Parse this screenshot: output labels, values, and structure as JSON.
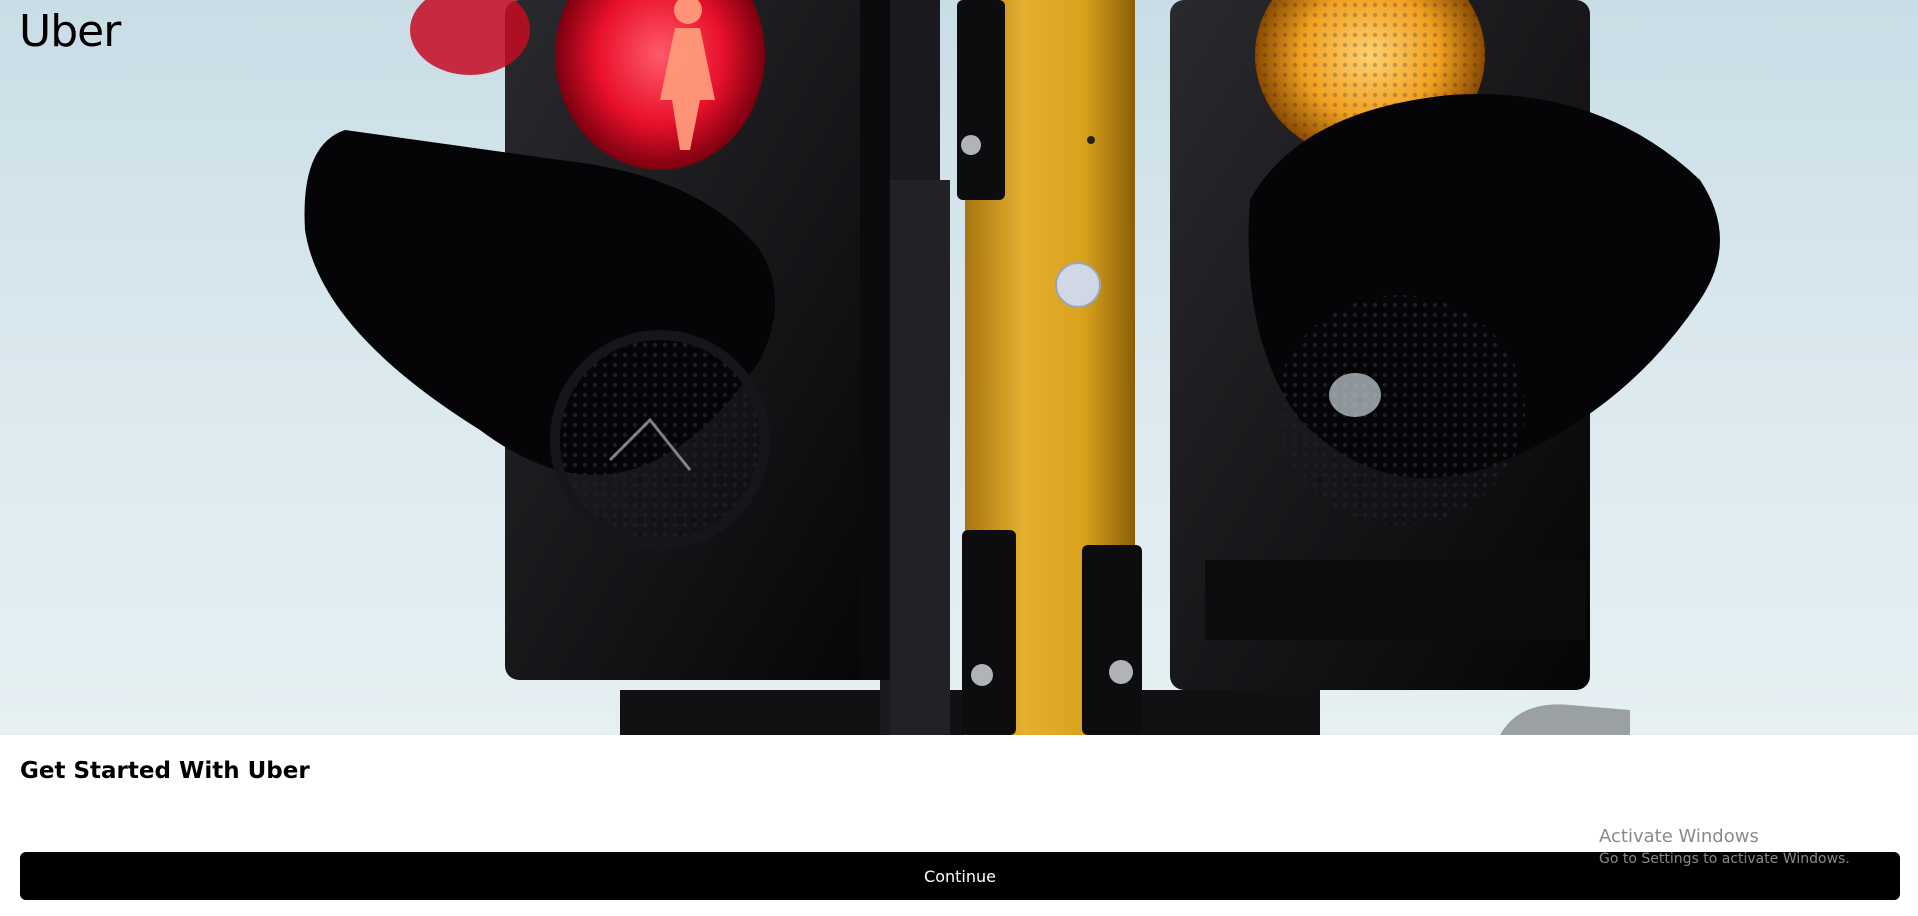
{
  "brand": {
    "logo_text": "Uber"
  },
  "hero": {
    "image_subject": "traffic-lights-photo"
  },
  "onboarding": {
    "title": "Get Started With Uber",
    "continue_label": "Continue"
  },
  "os_watermark": {
    "line1": "Activate Windows",
    "line2": "Go to Settings to activate Windows."
  },
  "colors": {
    "button_bg": "#000000",
    "button_text": "#ffffff",
    "red_light": "#e8102a",
    "amber_light": "#f0a020",
    "pole": "#d9a21c"
  }
}
